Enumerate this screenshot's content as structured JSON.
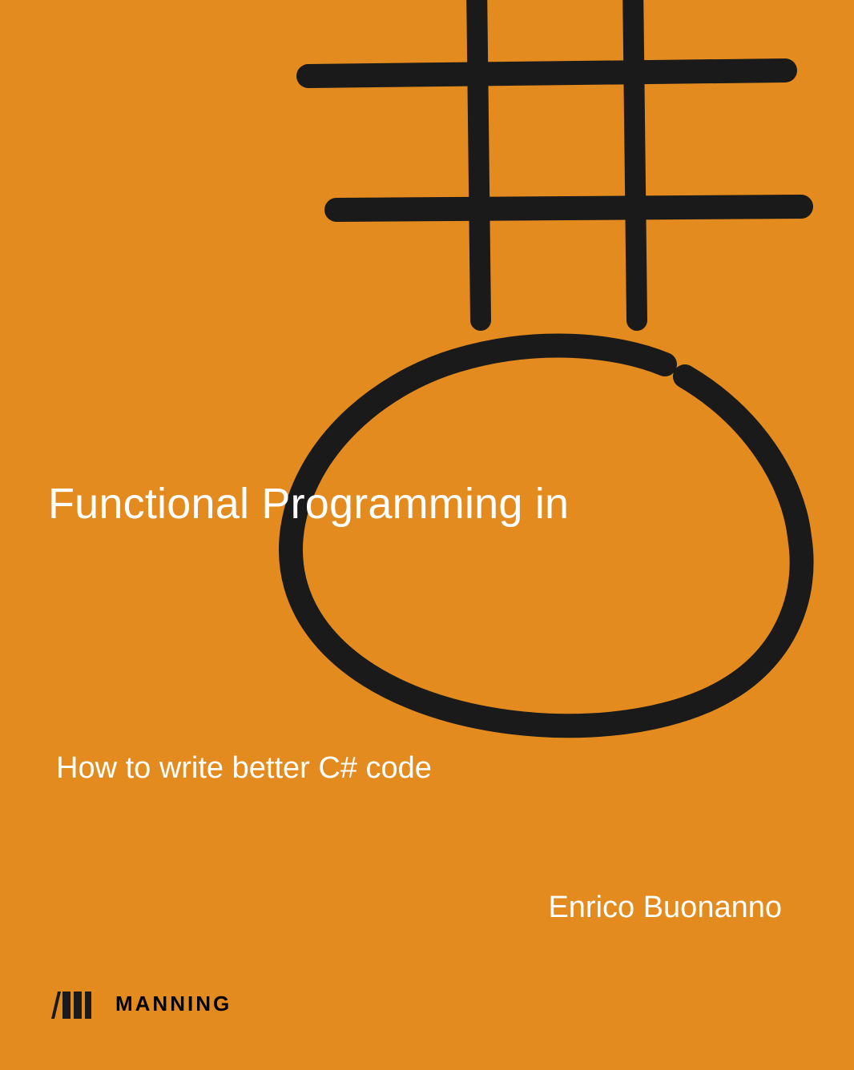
{
  "cover": {
    "title": "Functional Programming in",
    "subtitle": "How to write better C# code",
    "author": "Enrico Buonanno",
    "publisher": "MANNING",
    "background_color": "#e38b1e",
    "text_color": "#ffffff",
    "accent_color": "#000000",
    "graphic_description": "Large stylized C# symbol drawn in rough black brush strokes"
  }
}
